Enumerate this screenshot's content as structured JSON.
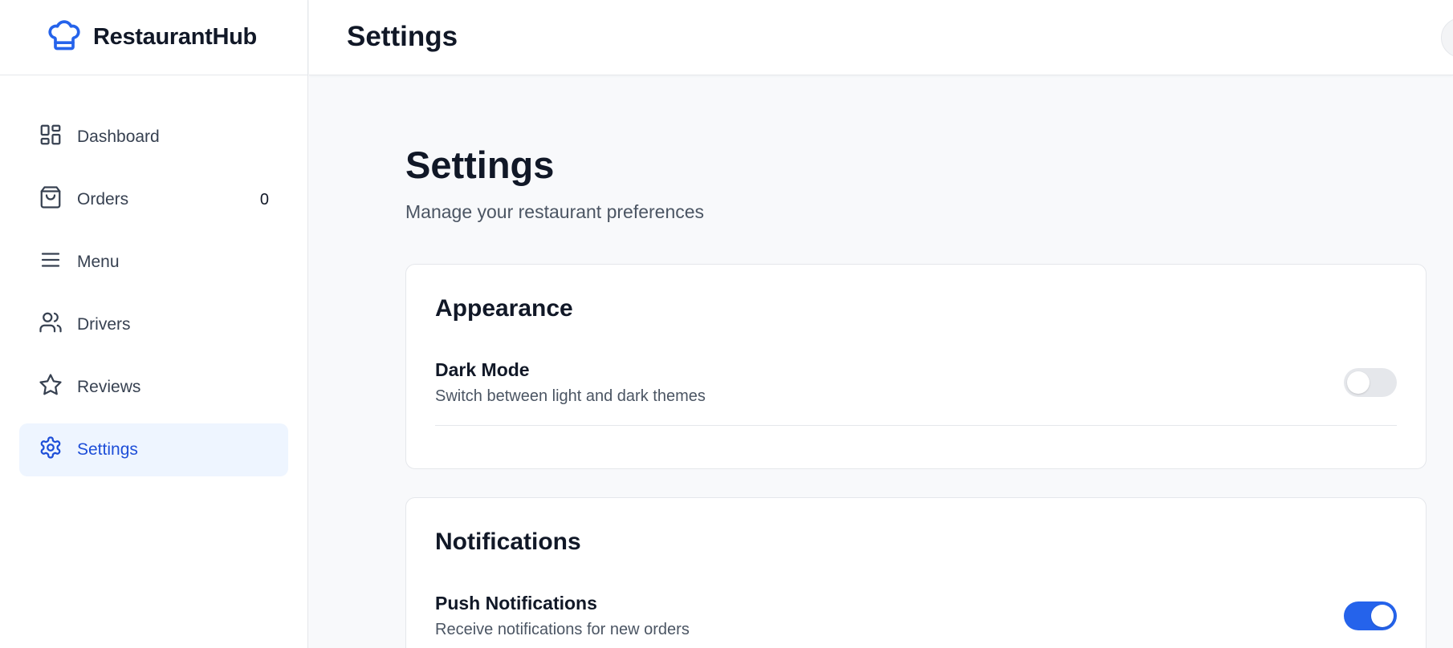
{
  "brand": {
    "name": "RestaurantHub",
    "logo_icon": "chef-hat-icon"
  },
  "colors": {
    "accent": "#2563eb",
    "active_bg": "#eef5ff",
    "active_text": "#1d4ed8"
  },
  "sidebar": {
    "items": [
      {
        "label": "Dashboard",
        "icon": "dashboard-icon",
        "active": false
      },
      {
        "label": "Orders",
        "icon": "shopping-bag-icon",
        "count": "0",
        "active": false
      },
      {
        "label": "Menu",
        "icon": "menu-icon",
        "active": false
      },
      {
        "label": "Drivers",
        "icon": "users-icon",
        "active": false
      },
      {
        "label": "Reviews",
        "icon": "star-icon",
        "active": false
      },
      {
        "label": "Settings",
        "icon": "gear-icon",
        "active": true
      }
    ]
  },
  "header": {
    "title": "Settings"
  },
  "main": {
    "title": "Settings",
    "subtitle": "Manage your restaurant preferences",
    "sections": [
      {
        "title": "Appearance",
        "settings": [
          {
            "label": "Dark Mode",
            "description": "Switch between light and dark themes",
            "enabled": false
          }
        ]
      },
      {
        "title": "Notifications",
        "settings": [
          {
            "label": "Push Notifications",
            "description": "Receive notifications for new orders",
            "enabled": true
          }
        ]
      }
    ]
  }
}
